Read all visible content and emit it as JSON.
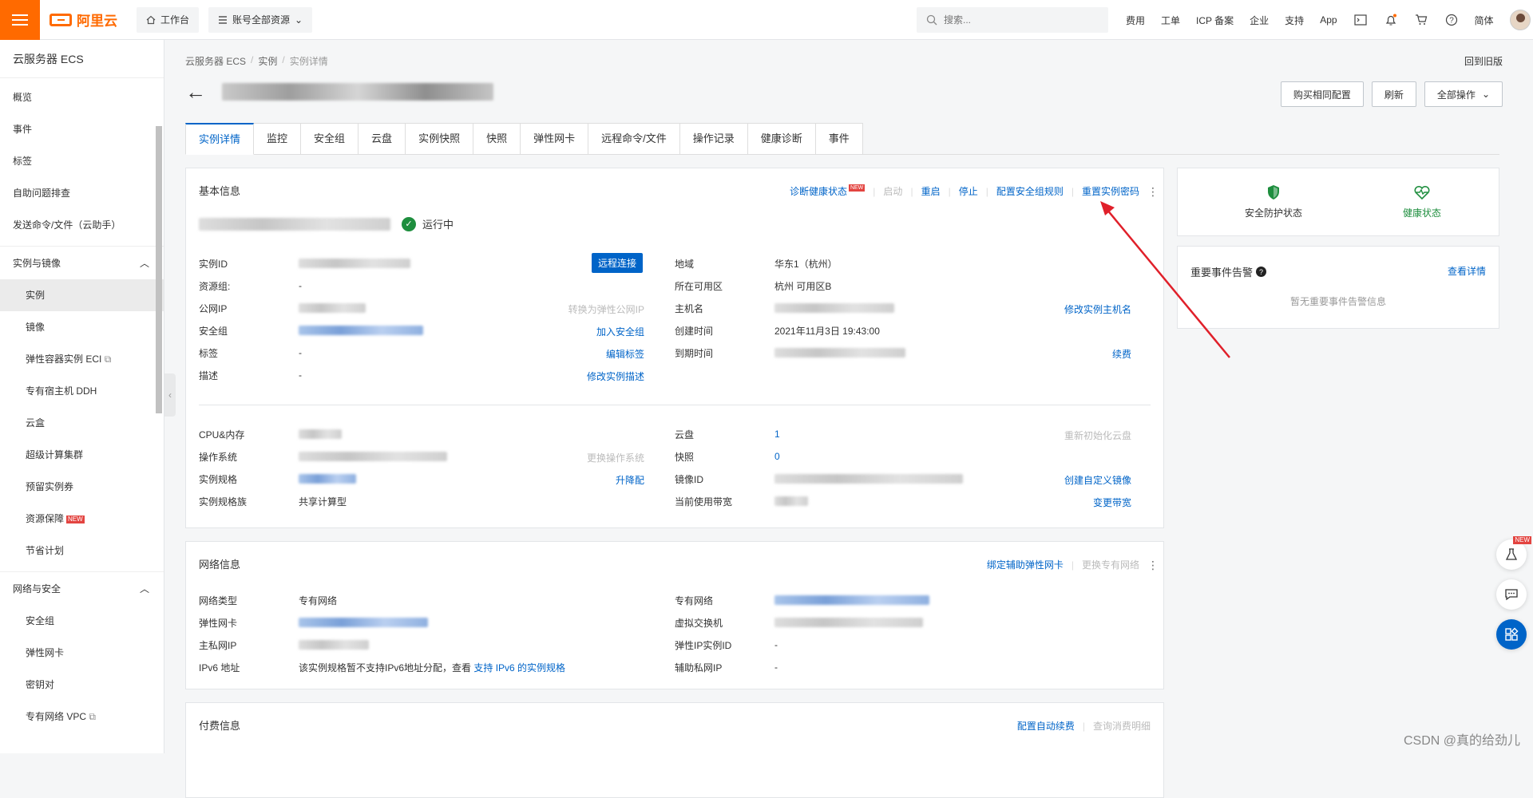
{
  "brand": {
    "name": "阿里云"
  },
  "topbar": {
    "workbench": "工作台",
    "resources": "账号全部资源",
    "search_placeholder": "搜索...",
    "links": [
      "费用",
      "工单",
      "ICP 备案",
      "企业",
      "支持",
      "App"
    ],
    "lang": "简体"
  },
  "sidebar": {
    "title": "云服务器 ECS",
    "top_items": [
      "概览",
      "事件",
      "标签",
      "自助问题排查",
      "发送命令/文件（云助手）"
    ],
    "group1": "实例与镜像",
    "group1_items": [
      "实例",
      "镜像",
      "弹性容器实例 ECI",
      "专有宿主机 DDH",
      "云盒",
      "超级计算集群",
      "预留实例券",
      "资源保障",
      "节省计划"
    ],
    "group1_new_label": "NEW",
    "group2": "网络与安全",
    "group2_items": [
      "安全组",
      "弹性网卡",
      "密钥对",
      "专有网络 VPC"
    ]
  },
  "breadcrumb": [
    "云服务器 ECS",
    "实例",
    "实例详情"
  ],
  "back_old": "回到旧版",
  "actions": {
    "buy_same": "购买相同配置",
    "refresh": "刷新",
    "all_ops": "全部操作"
  },
  "tabs": [
    "实例详情",
    "监控",
    "安全组",
    "云盘",
    "实例快照",
    "快照",
    "弹性网卡",
    "远程命令/文件",
    "操作记录",
    "健康诊断",
    "事件"
  ],
  "basic": {
    "title": "基本信息",
    "links": {
      "diagnose": "诊断健康状态",
      "new": "NEW",
      "start": "启动",
      "restart": "重启",
      "stop": "停止",
      "config_sg": "配置安全组规则",
      "reset_pwd": "重置实例密码"
    },
    "status": "运行中",
    "remote": "远程连接",
    "left": [
      {
        "label": "实例ID",
        "value": ""
      },
      {
        "label": "资源组:",
        "value": "-"
      },
      {
        "label": "公网IP",
        "value": "",
        "action": "转换为弹性公网IP"
      },
      {
        "label": "安全组",
        "value": "",
        "action": "加入安全组"
      },
      {
        "label": "标签",
        "value": "-",
        "action": "编辑标签"
      },
      {
        "label": "描述",
        "value": "-",
        "action": "修改实例描述"
      }
    ],
    "right": [
      {
        "label": "地域",
        "value": "华东1（杭州）"
      },
      {
        "label": "所在可用区",
        "value": "杭州 可用区B"
      },
      {
        "label": "主机名",
        "value": "",
        "action": "修改实例主机名"
      },
      {
        "label": "创建时间",
        "value": "2021年11月3日 19:43:00"
      },
      {
        "label": "到期时间",
        "value": "",
        "action": "续费"
      }
    ],
    "left2": [
      {
        "label": "CPU&内存",
        "value": ""
      },
      {
        "label": "操作系统",
        "value": "",
        "action": "更换操作系统"
      },
      {
        "label": "实例规格",
        "value": "",
        "action": "升降配"
      },
      {
        "label": "实例规格族",
        "value": "共享计算型"
      }
    ],
    "right2": [
      {
        "label": "云盘",
        "value": "1",
        "action": "重新初始化云盘"
      },
      {
        "label": "快照",
        "value": "0"
      },
      {
        "label": "镜像ID",
        "value": "",
        "action": "创建自定义镜像"
      },
      {
        "label": "当前使用带宽",
        "value": "",
        "action": "变更带宽"
      }
    ]
  },
  "status_card": {
    "security": "安全防护状态",
    "health": "健康状态"
  },
  "events_card": {
    "title": "重要事件告警",
    "detail": "查看详情",
    "empty": "暂无重要事件告警信息"
  },
  "network": {
    "title": "网络信息",
    "bind_eni": "绑定辅助弹性网卡",
    "change_vpc": "更换专有网络",
    "left": [
      {
        "label": "网络类型",
        "value": "专有网络"
      },
      {
        "label": "弹性网卡",
        "value": ""
      },
      {
        "label": "主私网IP",
        "value": ""
      },
      {
        "label": "IPv6 地址",
        "value": "该实例规格暂不支持IPv6地址分配，查看",
        "link": "支持 IPv6 的实例规格"
      }
    ],
    "right": [
      {
        "label": "专有网络",
        "value": ""
      },
      {
        "label": "虚拟交换机",
        "value": ""
      },
      {
        "label": "弹性IP实例ID",
        "value": "-"
      },
      {
        "label": "辅助私网IP",
        "value": "-"
      }
    ]
  },
  "billing": {
    "title": "付费信息",
    "auto_renew": "配置自动续费",
    "query": "查询消费明细"
  },
  "watermark": "CSDN @真的给劲儿",
  "colors": {
    "accent": "#0064c8",
    "brand": "#ff6a00",
    "ok": "#1e8e3e",
    "alert_arrow": "#e0202a"
  }
}
